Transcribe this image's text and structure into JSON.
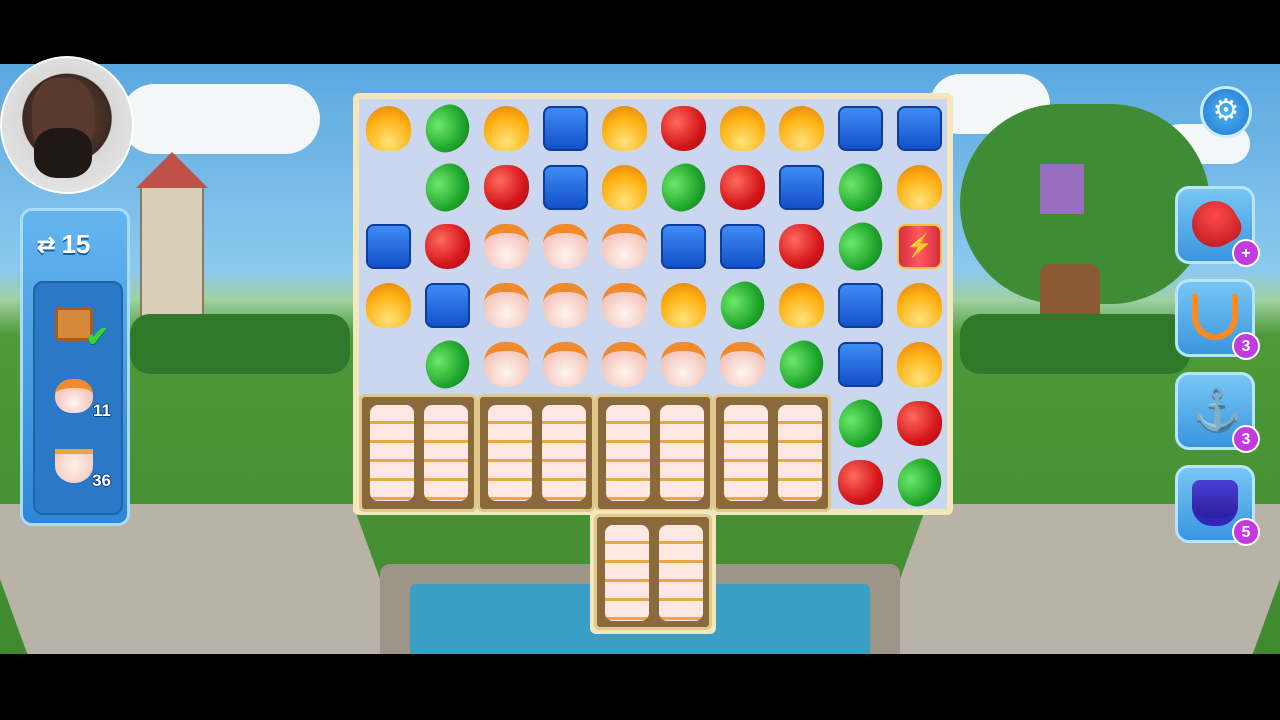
{
  "moves": {
    "swap_icon": "⇄",
    "count": "15"
  },
  "goals": [
    {
      "name": "crate",
      "count": "",
      "completed": true
    },
    {
      "name": "sugar-pot",
      "count": "11"
    },
    {
      "name": "teacup",
      "count": "36"
    }
  ],
  "board": {
    "cols": 10,
    "rows": [
      [
        "shell",
        "bean",
        "shell",
        "book",
        "shell",
        "apple",
        "shell",
        "shell",
        "book",
        "book"
      ],
      [
        "",
        "bean",
        "apple",
        "book",
        "shell",
        "bean",
        "apple",
        "book",
        "bean",
        "shell"
      ],
      [
        "book",
        "apple",
        "pot",
        "pot",
        "pot",
        "book",
        "book",
        "apple",
        "bean",
        "dynamite"
      ],
      [
        "shell",
        "book",
        "pot",
        "pot",
        "pot",
        "shell",
        "bean",
        "shell",
        "book",
        "shell"
      ],
      [
        "",
        "bean",
        "pot",
        "pot",
        "pot",
        "pot",
        "pot",
        "bean",
        "book",
        "shell"
      ],
      [
        "",
        "",
        "",
        "",
        "",
        "",
        "",
        "",
        "bean",
        "apple"
      ],
      [
        "",
        "",
        "",
        "",
        "",
        "",
        "",
        "",
        "apple",
        "bean"
      ]
    ],
    "cupboards": 5
  },
  "boosters": [
    {
      "name": "boxing-glove-icon",
      "badge": "+"
    },
    {
      "name": "slingshot-icon",
      "badge": "3"
    },
    {
      "name": "anchor-icon",
      "badge": "3"
    },
    {
      "name": "magic-hat-icon",
      "badge": "5"
    }
  ],
  "settings": {
    "icon": "⚙"
  },
  "colors": {
    "panel": "#2f86d6",
    "board": "#cbd7ee",
    "badge": "#c23ae0"
  }
}
